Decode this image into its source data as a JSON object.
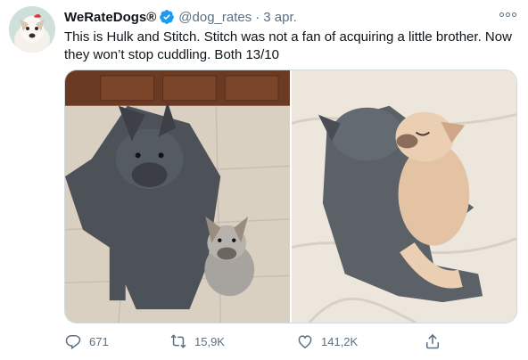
{
  "tweet": {
    "author_name": "WeRateDogs®",
    "handle": "@dog_rates",
    "separator": "·",
    "date": "3 apr.",
    "text": "This is Hulk and Stitch. Stitch was not a fan of acquiring a little brother. Now they won’t stop cuddling. Both 13/10",
    "verified": true,
    "media_count": 2
  },
  "actions": {
    "reply_count": "671",
    "retweet_count": "15,9K",
    "like_count": "141,2K"
  },
  "icons": {
    "avatar": "dog-avatar-icon",
    "verified": "verified-badge-icon",
    "more": "more-options-icon",
    "reply": "reply-icon",
    "retweet": "retweet-icon",
    "like": "like-icon",
    "share": "share-icon"
  },
  "colors": {
    "text": "#0f1419",
    "secondary": "#5b7083",
    "verified": "#1d9bf0",
    "border": "#cfd9de"
  }
}
